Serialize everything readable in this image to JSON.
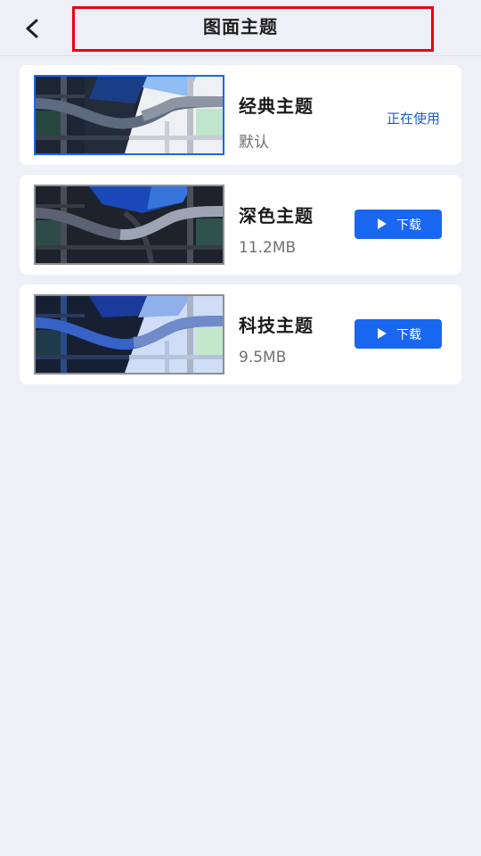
{
  "header": {
    "title": "图面主题",
    "back_icon": "chevron-left-icon"
  },
  "themes": [
    {
      "name": "经典主题",
      "subtitle": "默认",
      "status": "正在使用",
      "selected": true,
      "accent": "#1967f0"
    },
    {
      "name": "深色主题",
      "subtitle": "11.2MB",
      "action_label": "下载",
      "action_icon": "play-icon"
    },
    {
      "name": "科技主题",
      "subtitle": "9.5MB",
      "action_label": "下载",
      "action_icon": "play-icon"
    }
  ],
  "colors": {
    "background": "#eff0f7",
    "card": "#ffffff",
    "primary": "#1967f0",
    "highlight_border": "#e60012"
  }
}
